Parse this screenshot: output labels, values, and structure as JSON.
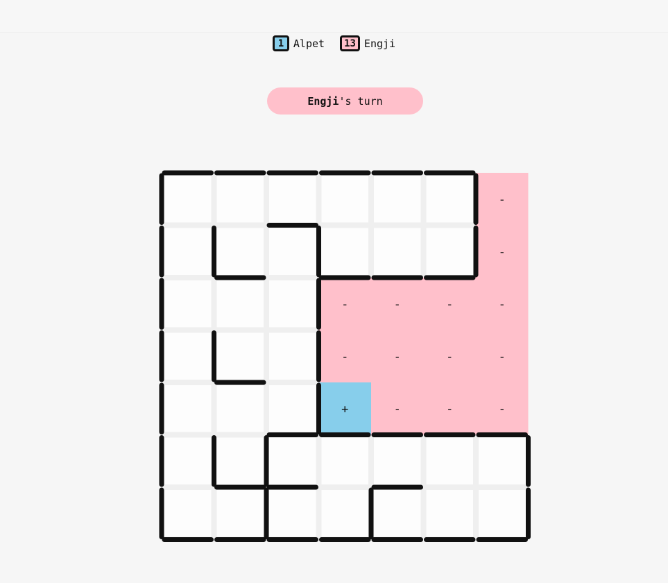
{
  "colors": {
    "alpet": "#87ceeb",
    "engji": "#ffc0cb",
    "cell_empty": "#fdfdfd",
    "grid_gap": "#efefef",
    "wall": "#111111"
  },
  "players": [
    {
      "name": "Alpet",
      "score": "1",
      "color": "#87ceeb"
    },
    {
      "name": "Engji",
      "score": "13",
      "color": "#ffc0cb"
    }
  ],
  "turn": {
    "player": "Engji",
    "suffix": "'s turn",
    "color": "#ffc0cb"
  },
  "board": {
    "rows": 7,
    "cols": 7,
    "cells": [
      [
        "",
        "",
        "",
        "",
        "",
        "",
        "-"
      ],
      [
        "",
        "",
        "",
        "",
        "",
        "",
        "-"
      ],
      [
        "",
        "",
        "",
        "-",
        "-",
        "-",
        "-"
      ],
      [
        "",
        "",
        "",
        "-",
        "-",
        "-",
        "-"
      ],
      [
        "",
        "",
        "",
        "+",
        "-",
        "-",
        "-"
      ],
      [
        "",
        "",
        "",
        "",
        "",
        "",
        ""
      ],
      [
        "",
        "",
        "",
        "",
        "",
        "",
        ""
      ]
    ],
    "owners": [
      [
        "",
        "",
        "",
        "",
        "",
        "",
        "engji"
      ],
      [
        "",
        "",
        "",
        "",
        "",
        "",
        "engji"
      ],
      [
        "",
        "",
        "",
        "engji",
        "engji",
        "engji",
        "engji"
      ],
      [
        "",
        "",
        "",
        "engji",
        "engji",
        "engji",
        "engji"
      ],
      [
        "",
        "",
        "",
        "alpet",
        "engji",
        "engji",
        "engji"
      ],
      [
        "",
        "",
        "",
        "",
        "",
        "",
        ""
      ],
      [
        "",
        "",
        "",
        "",
        "",
        "",
        ""
      ]
    ],
    "h_walls": [
      [
        0,
        0
      ],
      [
        0,
        1
      ],
      [
        0,
        2
      ],
      [
        0,
        3
      ],
      [
        0,
        4
      ],
      [
        0,
        5
      ],
      [
        1,
        2
      ],
      [
        2,
        1
      ],
      [
        2,
        3
      ],
      [
        2,
        4
      ],
      [
        2,
        5
      ],
      [
        4,
        1
      ],
      [
        5,
        2
      ],
      [
        5,
        3
      ],
      [
        5,
        4
      ],
      [
        5,
        5
      ],
      [
        5,
        6
      ],
      [
        6,
        1
      ],
      [
        6,
        2
      ],
      [
        6,
        4
      ],
      [
        7,
        0
      ],
      [
        7,
        1
      ],
      [
        7,
        2
      ],
      [
        7,
        3
      ],
      [
        7,
        4
      ],
      [
        7,
        5
      ],
      [
        7,
        6
      ]
    ],
    "v_walls": [
      [
        0,
        0
      ],
      [
        1,
        0
      ],
      [
        2,
        0
      ],
      [
        3,
        0
      ],
      [
        4,
        0
      ],
      [
        5,
        0
      ],
      [
        6,
        0
      ],
      [
        1,
        1
      ],
      [
        3,
        1
      ],
      [
        5,
        1
      ],
      [
        1,
        3
      ],
      [
        2,
        3
      ],
      [
        3,
        3
      ],
      [
        4,
        3
      ],
      [
        5,
        2
      ],
      [
        6,
        2
      ],
      [
        6,
        4
      ],
      [
        0,
        6
      ],
      [
        1,
        6
      ],
      [
        5,
        7
      ],
      [
        6,
        7
      ]
    ]
  }
}
